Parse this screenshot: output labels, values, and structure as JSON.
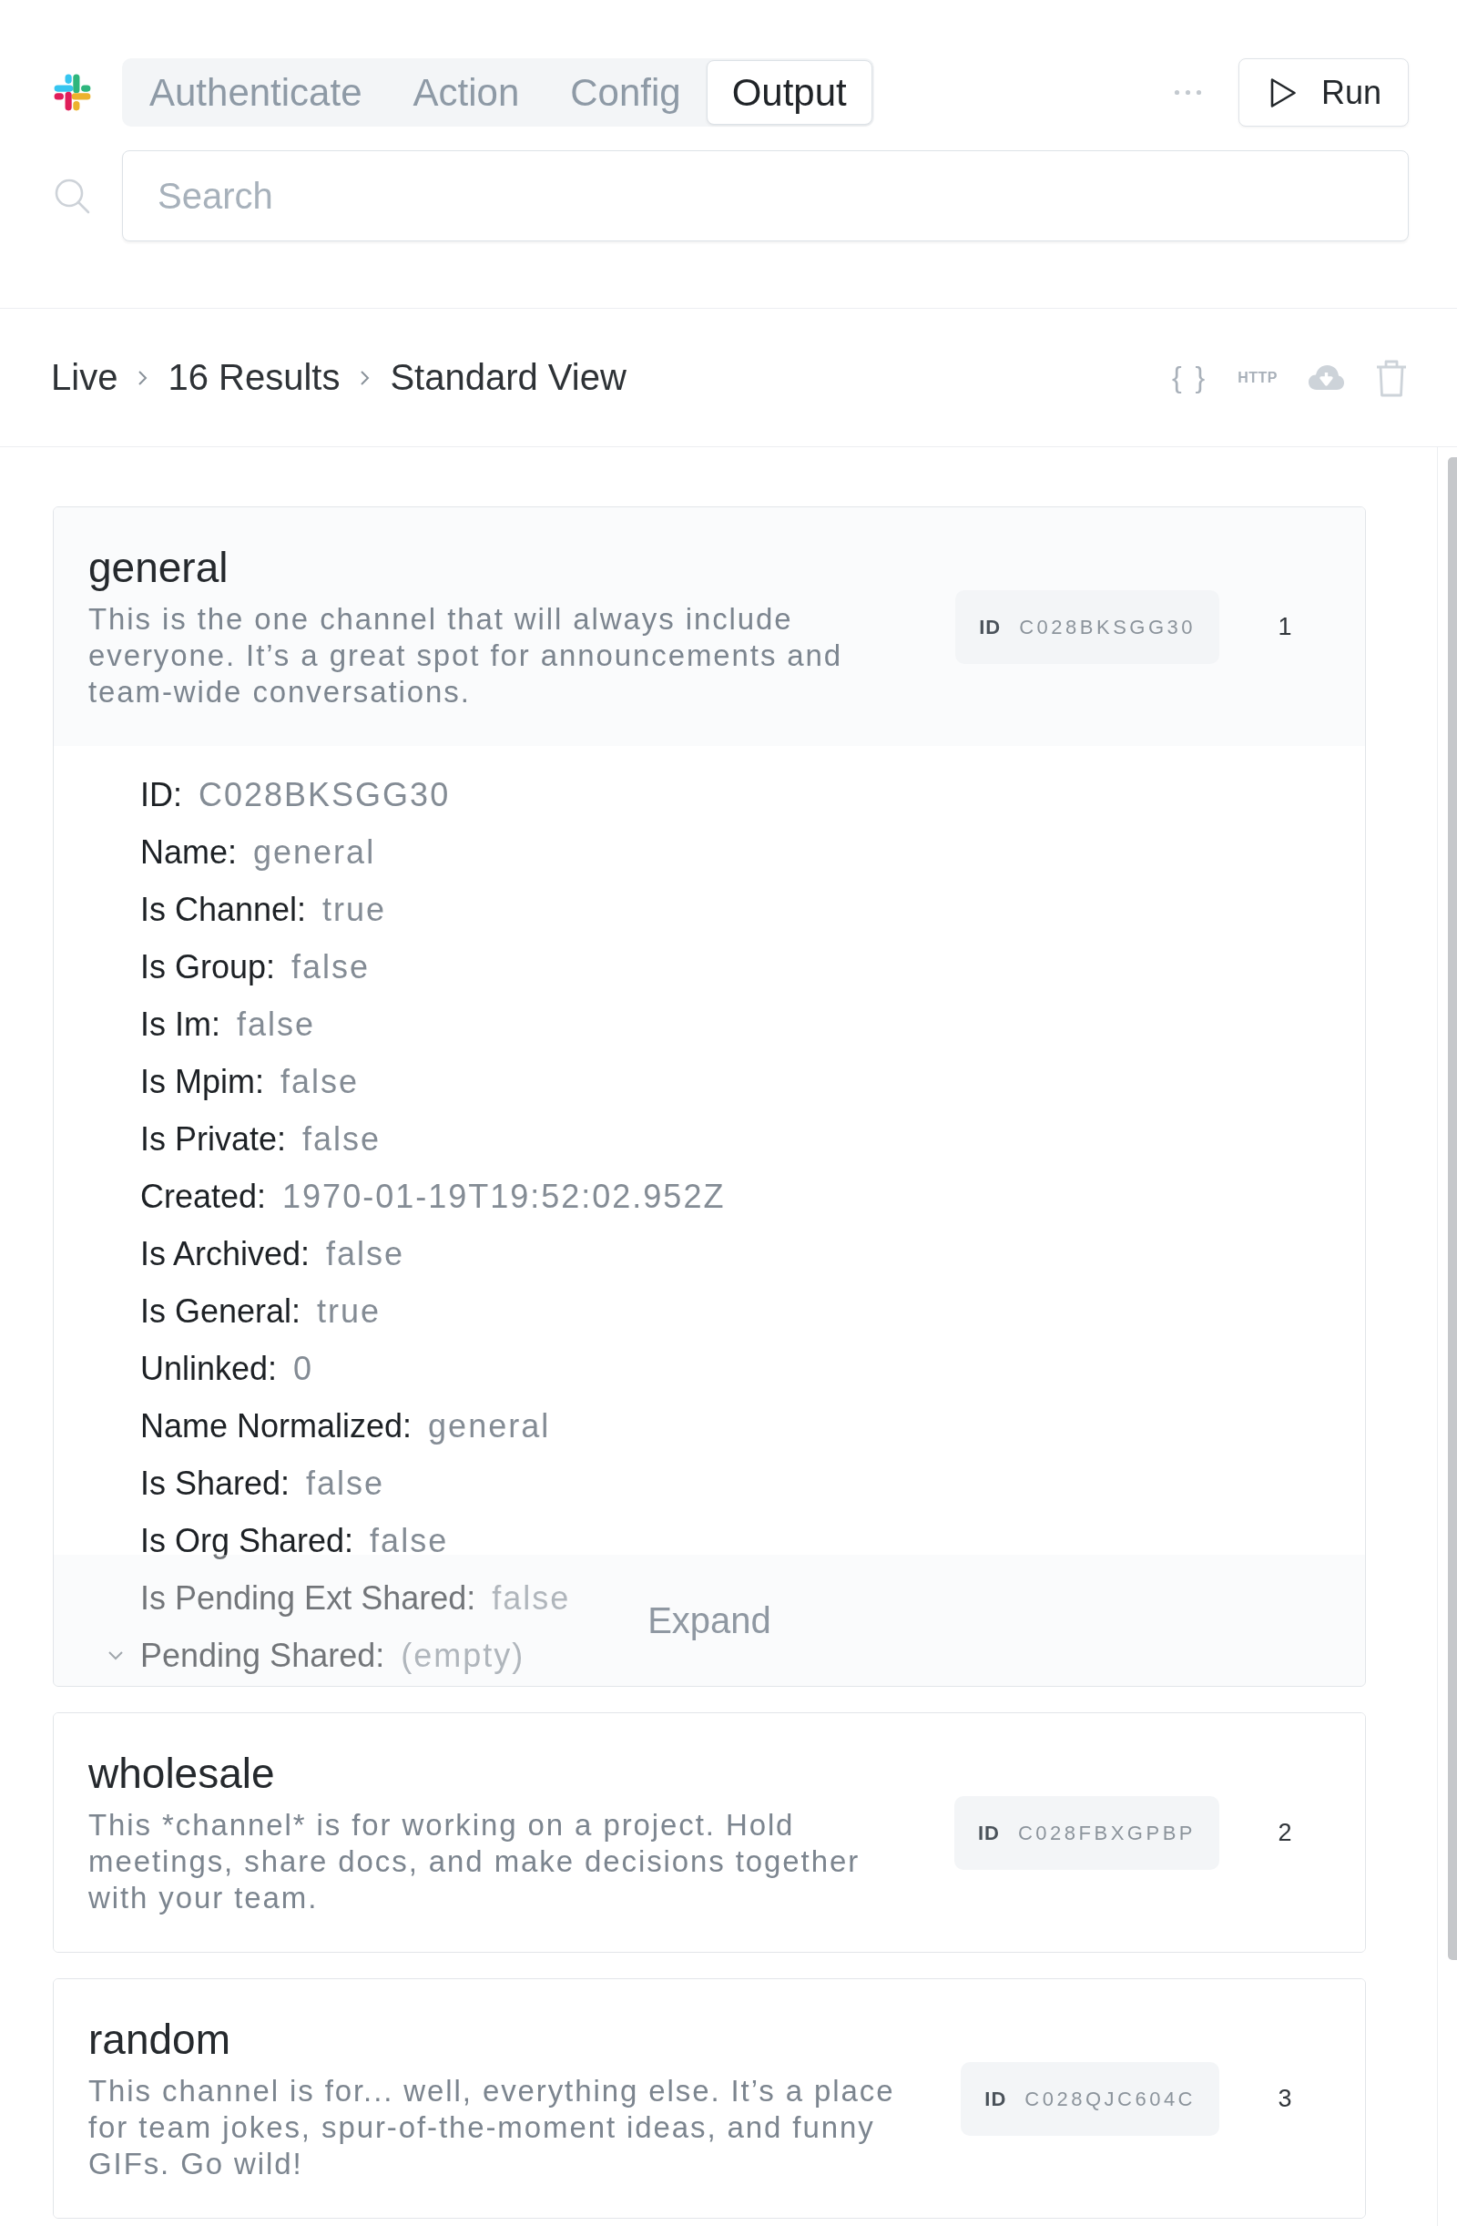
{
  "header": {
    "tabs": [
      {
        "label": "Authenticate",
        "selected": false
      },
      {
        "label": "Action",
        "selected": false
      },
      {
        "label": "Config",
        "selected": false
      },
      {
        "label": "Output",
        "selected": true
      }
    ],
    "run_button": {
      "label": "Run"
    },
    "search": {
      "placeholder": "Search"
    }
  },
  "breadcrumb": {
    "items": [
      "Live",
      "16 Results",
      "Standard View"
    ],
    "actions": {
      "disabled": true,
      "text_buttons": [
        "{ }",
        "HTTP"
      ]
    }
  },
  "results": [
    {
      "title": "general",
      "description": "This is the one channel that will always include everyone. It’s a great spot for announcements and team-wide conversations.",
      "id_label": "ID",
      "id": "C028BKSGG30",
      "index": "1",
      "expanded": true,
      "properties": [
        {
          "kind": "field",
          "label": "ID:",
          "value": "C028BKSGG30"
        },
        {
          "kind": "field",
          "label": "Name:",
          "value": "general"
        },
        {
          "kind": "field",
          "label": "Is Channel:",
          "value": "true"
        },
        {
          "kind": "field",
          "label": "Is Group:",
          "value": "false"
        },
        {
          "kind": "field",
          "label": "Is Im:",
          "value": "false"
        },
        {
          "kind": "field",
          "label": "Is Mpim:",
          "value": "false"
        },
        {
          "kind": "field",
          "label": "Is Private:",
          "value": "false"
        },
        {
          "kind": "field",
          "label": "Created:",
          "value": "1970-01-19T19:52:02.952Z"
        },
        {
          "kind": "field",
          "label": "Is Archived:",
          "value": "false"
        },
        {
          "kind": "field",
          "label": "Is General:",
          "value": "true"
        },
        {
          "kind": "field",
          "label": "Unlinked:",
          "value": "0"
        },
        {
          "kind": "field",
          "label": "Name Normalized:",
          "value": "general"
        },
        {
          "kind": "field",
          "label": "Is Shared:",
          "value": "false"
        },
        {
          "kind": "field",
          "label": "Is Org Shared:",
          "value": "false"
        },
        {
          "kind": "field",
          "label": "Is Pending Ext Shared:",
          "value": "false"
        },
        {
          "kind": "group",
          "label": "Pending Shared:",
          "value": "(empty)"
        }
      ],
      "expand_label": "Expand"
    },
    {
      "title": "wholesale",
      "description": "This *channel* is for working on a project. Hold meetings, share docs, and make decisions together with your team.",
      "id_label": "ID",
      "id": "C028FBXGPBP",
      "index": "2",
      "expanded": false
    },
    {
      "title": "random",
      "description": "This channel is for... well, everything else. It’s a place for team jokes, spur-of-the-moment ideas, and funny GIFs. Go wild!",
      "id_label": "ID",
      "id": "C028QJC604C",
      "index": "3",
      "expanded": false
    }
  ]
}
